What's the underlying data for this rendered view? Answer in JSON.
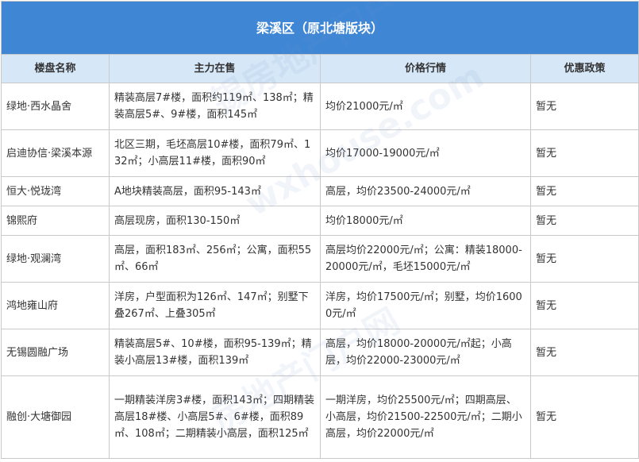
{
  "title": "梁溪区（原北塘版块）",
  "columns": [
    "楼盘名称",
    "主力在售",
    "价格行情",
    "优惠政策"
  ],
  "rows": [
    {
      "name": "绿地·西水晶舍",
      "supply": "精装高层7#楼，面积约119㎡、138㎡；精装高层5#、9#楼，面积145㎡",
      "price": "均价21000元/㎡",
      "policy": "暂无"
    },
    {
      "name": "启迪协信·梁溪本源",
      "supply": "北区三期，毛坯高层10#楼，面积79㎡、132㎡；小高层11#楼，面积90㎡",
      "price": "均价17000-19000元/㎡",
      "policy": "暂无"
    },
    {
      "name": "恒大·悦珑湾",
      "supply": "A地块精装高层，面积95-143㎡",
      "price": "高层，均价23500-24000元/㎡",
      "policy": "暂无"
    },
    {
      "name": "锦熙府",
      "supply": "高层现房，面积130-150㎡",
      "price": "均价18000元/㎡",
      "policy": "暂无"
    },
    {
      "name": "绿地·观澜湾",
      "supply": "高层，面积183㎡、256㎡；公寓，面积55㎡、66㎡",
      "price": "高层均价22000元/㎡；公寓：精装18000-20000元/㎡，毛坯15000元/㎡",
      "policy": "暂无"
    },
    {
      "name": "鸿地雍山府",
      "supply": "洋房，户型面积为126㎡、147㎡；别墅下叠267㎡、上叠305㎡",
      "price": "洋房，均价17500元/㎡；别墅，均价16000元/㎡",
      "policy": "暂无"
    },
    {
      "name": "无锡圆融广场",
      "supply": "精装高层5#、10#楼，面积95-139㎡；精装小高层13#楼，面积139㎡",
      "price": "高层，均价18000-20000元/㎡起；小高层，均价22000-23000元/㎡",
      "policy": "暂无"
    },
    {
      "name": "融创·大塘御园",
      "supply": "一期精装洋房3#楼，面积143㎡；四期精装高层18#楼、小高层5#、6#楼，面积89㎡、108㎡；二期精装小高层，面积125㎡",
      "price": "一期洋房，均价25500元/㎡；四期高层、小高层，均价21500-22500元/㎡；二期小高层，均价22000元/㎡",
      "policy": "暂无"
    }
  ],
  "watermark": [
    "锡房地产门户",
    "wxhouse.com",
    "房地产门户网"
  ]
}
